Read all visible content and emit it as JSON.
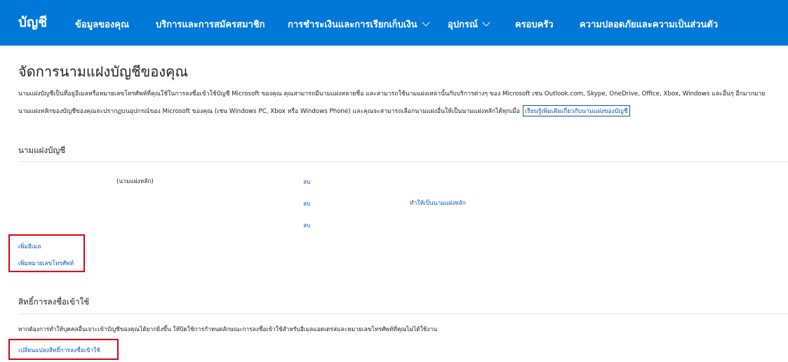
{
  "nav": {
    "brand": "บัญชี",
    "items": [
      {
        "label": "ข้อมูลของคุณ"
      },
      {
        "label": "บริการและการสมัครสมาชิก"
      },
      {
        "label": "การชำระเงินและการเรียกเก็บเงิน"
      },
      {
        "label": "อุปกรณ์"
      },
      {
        "label": "ครอบครัว"
      },
      {
        "label": "ความปลอดภัยและความเป็นส่วนตัว"
      }
    ]
  },
  "page": {
    "title": "จัดการนามแฝงบัญชีของคุณ",
    "description_line1": "นามแฝงบัญชีเป็นที่อยู่อีเมลหรือหมายเลขโทรศัพท์ที่คุณใช้ในการลงชื่อเข้าใช้บัญชี Microsoft ของคุณ คุณสามารถมีนามแฝงหลายชื่อ และสามารถใช้นามแฝงเหล่านั้นกับบริการต่างๆ ของ Microsoft เช่น Outlook.com, Skype, OneDrive, Office, Xbox, Windows และอื่นๆ อีกมากมาย",
    "description_line2": "นามแฝงหลักของบัญชีของคุณจะปรากฏบนอุปกรณ์ของ Microsoft ของคุณ (เช่น Windows PC, Xbox หรือ Windows Phone) และคุณจะสามารถเลือกนามแฝงอื่นให้เป็นนามแฝงหลักได้ทุกเมื่อ",
    "learn_more": "เรียนรู้เพิ่มเติมเกี่ยวกับนามแฝงของบัญชี"
  },
  "aliases": {
    "section_title": "นามแฝงบัญชี",
    "primary_label": "(นามแฝงหลัก)",
    "rows": [
      {
        "remove": "ลบ",
        "make_primary": ""
      },
      {
        "remove": "ลบ",
        "make_primary": "ทำให้เป็นนามแฝงหลัก"
      },
      {
        "remove": "ลบ",
        "make_primary": ""
      }
    ],
    "add_email": "เพิ่มอีเมล",
    "add_phone": "เพิ่มหมายเลขโทรศัพท์"
  },
  "signin": {
    "section_title": "สิทธิ์การลงชื่อเข้าใช้",
    "description": "หากต้องการทำให้บุคคลอื่นเจาะเข้าบัญชีของคุณได้ยากยิ่งขึ้น ให้ปิดใช้การกำหนดลักษณะการลงชื่อเข้าใช้สำหรับอีเมลแอดเดรสและหมายเลขโทรศัพท์ที่คุณไม่ได้ใช้งาน",
    "change_link": "เปลี่ยนแปลงสิทธิ์การลงชื่อเข้าใช้"
  },
  "colors": {
    "nav_bg": "#0078d7",
    "link": "#0b58b5",
    "highlight": "#d9001b"
  }
}
